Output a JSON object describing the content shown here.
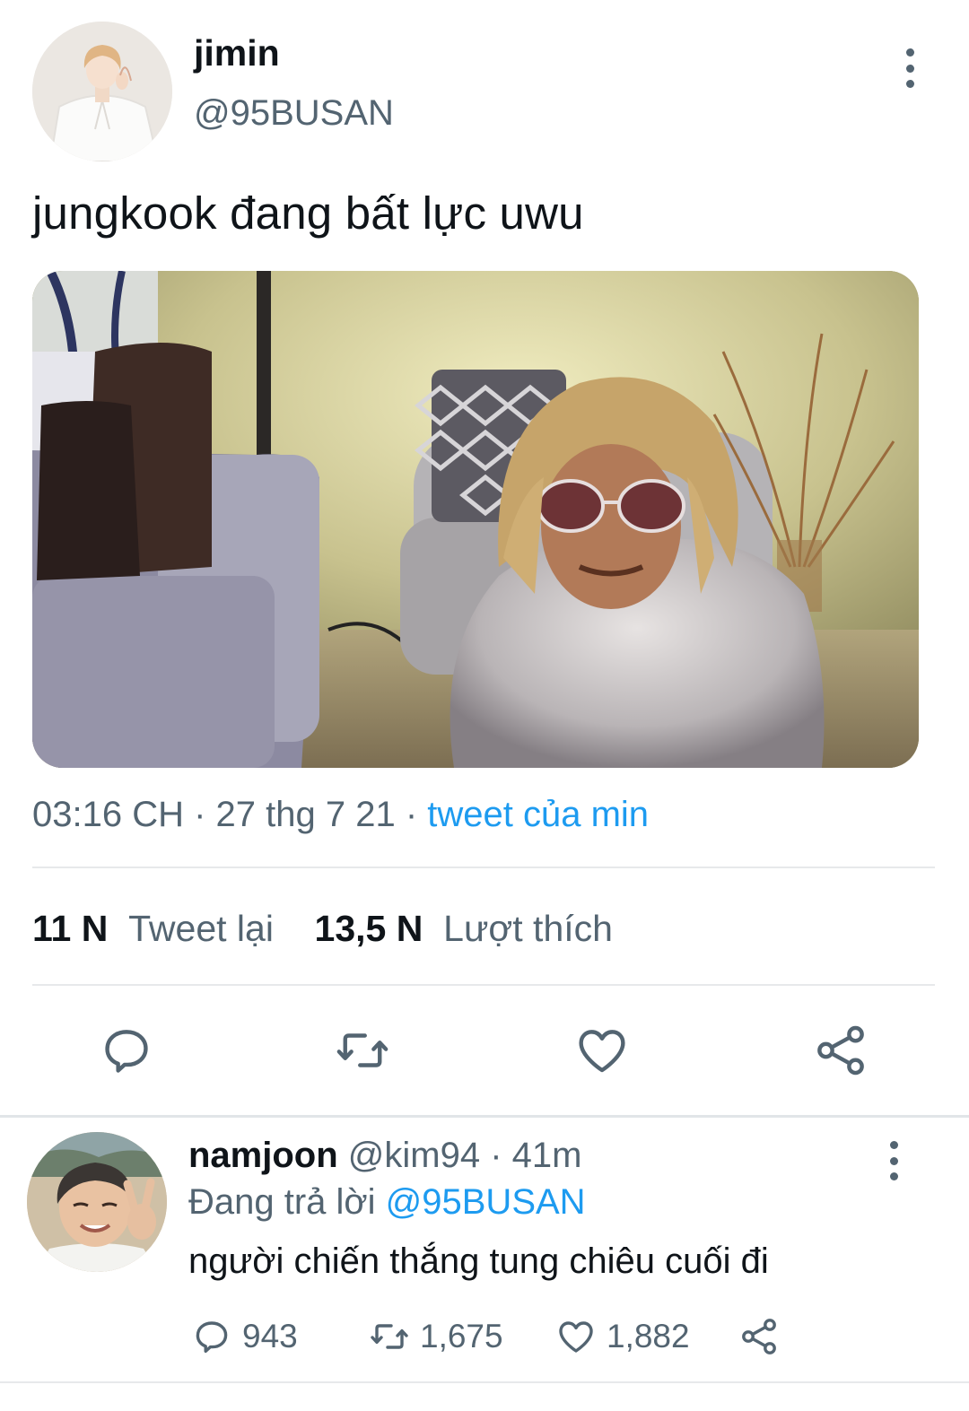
{
  "tweet": {
    "author_name": "jimin",
    "author_handle": "@95BUSAN",
    "text": "jungkook đang bất lực uwu",
    "timestamp": "03:16 CH · 27 thg 7 21 · ",
    "source": "tweet của min",
    "retweet_count": "11 N",
    "retweet_label": "Tweet lại",
    "like_count": "13,5 N",
    "like_label": "Lượt thích"
  },
  "reply": {
    "author_name": "namjoon",
    "author_handle": "@kim94",
    "time": " · 41m",
    "replying_prefix": "Đang trả lời ",
    "replying_handle": "@95BUSAN",
    "text": "người chiến thắng tung chiêu cuối đi",
    "reply_count": "943",
    "retweet_count": "1,675",
    "like_count": "1,882"
  },
  "icons": {
    "more": "more-vertical-icon",
    "reply": "reply-bubble-icon",
    "retweet": "retweet-icon",
    "like": "heart-icon",
    "share": "share-icon"
  },
  "colors": {
    "link": "#1d9bf0",
    "secondary_text": "#536471",
    "primary_text": "#0f1419",
    "divider": "#e7e9eb"
  }
}
